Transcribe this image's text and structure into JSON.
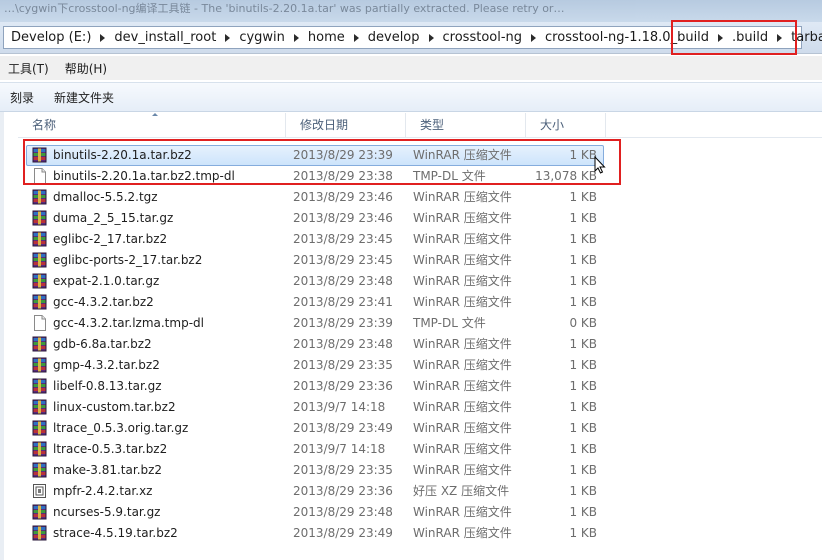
{
  "window": {
    "title": "…\\cygwin下crosstool-ng编译工具链 - The 'binutils-2.20.1a.tar' was partially extracted. Please retry or…"
  },
  "address_bar": {
    "crumbs": [
      "Develop (E:)",
      "dev_install_root",
      "cygwin",
      "home",
      "develop",
      "crosstool-ng",
      "crosstool-ng-1.18.0_build",
      ".build",
      "tarballs"
    ]
  },
  "menu": {
    "items": [
      "工具(T)",
      "帮助(H)"
    ]
  },
  "toolbar": {
    "buttons": [
      "刻录",
      "新建文件夹"
    ]
  },
  "columns": {
    "name": "名称",
    "date": "修改日期",
    "type": "类型",
    "size": "大小"
  },
  "files": [
    {
      "name": "binutils-2.20.1a.tar.bz2",
      "date": "2013/8/29 23:39",
      "type": "WinRAR 压缩文件",
      "size": "1 KB",
      "icon": "winrar-archive-icon",
      "selected": true
    },
    {
      "name": "binutils-2.20.1a.tar.bz2.tmp-dl",
      "date": "2013/8/29 23:38",
      "type": "TMP-DL 文件",
      "size": "13,078 KB",
      "icon": "blank-file-icon"
    },
    {
      "name": "dmalloc-5.5.2.tgz",
      "date": "2013/8/29 23:46",
      "type": "WinRAR 压缩文件",
      "size": "1 KB",
      "icon": "winrar-archive-icon"
    },
    {
      "name": "duma_2_5_15.tar.gz",
      "date": "2013/8/29 23:46",
      "type": "WinRAR 压缩文件",
      "size": "1 KB",
      "icon": "winrar-archive-icon"
    },
    {
      "name": "eglibc-2_17.tar.bz2",
      "date": "2013/8/29 23:45",
      "type": "WinRAR 压缩文件",
      "size": "1 KB",
      "icon": "winrar-archive-icon"
    },
    {
      "name": "eglibc-ports-2_17.tar.bz2",
      "date": "2013/8/29 23:45",
      "type": "WinRAR 压缩文件",
      "size": "1 KB",
      "icon": "winrar-archive-icon"
    },
    {
      "name": "expat-2.1.0.tar.gz",
      "date": "2013/8/29 23:48",
      "type": "WinRAR 压缩文件",
      "size": "1 KB",
      "icon": "winrar-archive-icon"
    },
    {
      "name": "gcc-4.3.2.tar.bz2",
      "date": "2013/8/29 23:41",
      "type": "WinRAR 压缩文件",
      "size": "1 KB",
      "icon": "winrar-archive-icon"
    },
    {
      "name": "gcc-4.3.2.tar.lzma.tmp-dl",
      "date": "2013/8/29 23:39",
      "type": "TMP-DL 文件",
      "size": "0 KB",
      "icon": "blank-file-icon"
    },
    {
      "name": "gdb-6.8a.tar.bz2",
      "date": "2013/8/29 23:48",
      "type": "WinRAR 压缩文件",
      "size": "1 KB",
      "icon": "winrar-archive-icon"
    },
    {
      "name": "gmp-4.3.2.tar.bz2",
      "date": "2013/8/29 23:35",
      "type": "WinRAR 压缩文件",
      "size": "1 KB",
      "icon": "winrar-archive-icon"
    },
    {
      "name": "libelf-0.8.13.tar.gz",
      "date": "2013/8/29 23:36",
      "type": "WinRAR 压缩文件",
      "size": "1 KB",
      "icon": "winrar-archive-icon"
    },
    {
      "name": "linux-custom.tar.bz2",
      "date": "2013/9/7 14:18",
      "type": "WinRAR 压缩文件",
      "size": "1 KB",
      "icon": "winrar-archive-icon"
    },
    {
      "name": "ltrace_0.5.3.orig.tar.gz",
      "date": "2013/8/29 23:49",
      "type": "WinRAR 压缩文件",
      "size": "1 KB",
      "icon": "winrar-archive-icon"
    },
    {
      "name": "ltrace-0.5.3.tar.bz2",
      "date": "2013/9/7 14:18",
      "type": "WinRAR 压缩文件",
      "size": "1 KB",
      "icon": "winrar-archive-icon"
    },
    {
      "name": "make-3.81.tar.bz2",
      "date": "2013/8/29 23:35",
      "type": "WinRAR 压缩文件",
      "size": "1 KB",
      "icon": "winrar-archive-icon"
    },
    {
      "name": "mpfr-2.4.2.tar.xz",
      "date": "2013/8/29 23:36",
      "type": "好压 XZ 压缩文件",
      "size": "1 KB",
      "icon": "haozip-archive-icon"
    },
    {
      "name": "ncurses-5.9.tar.gz",
      "date": "2013/8/29 23:48",
      "type": "WinRAR 压缩文件",
      "size": "1 KB",
      "icon": "winrar-archive-icon"
    },
    {
      "name": "strace-4.5.19.tar.bz2",
      "date": "2013/8/29 23:49",
      "type": "WinRAR 压缩文件",
      "size": "1 KB",
      "icon": "winrar-archive-icon"
    }
  ],
  "colors": {
    "highlight": "#e02020",
    "selection": "#cde4fb",
    "header_text": "#4c607a"
  }
}
